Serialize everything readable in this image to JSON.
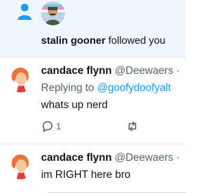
{
  "notification": {
    "follower_name": "stalin gooner",
    "action_text": " followed you"
  },
  "tweets": [
    {
      "display_name": "candace flynn",
      "handle": "@Deewaers",
      "separator": " ·",
      "replying_prefix": "Replying to ",
      "replying_to": "@goofydoofyalt",
      "text": "whats up nerd",
      "reply_count": "1"
    },
    {
      "display_name": "candace flynn",
      "handle": "@Deewaers",
      "separator": " ·",
      "text": "im RIGHT here bro"
    }
  ],
  "colors": {
    "accent": "#1d9bf0",
    "secondary_text": "#536471",
    "highlight_bg": "#f0f6fd"
  }
}
